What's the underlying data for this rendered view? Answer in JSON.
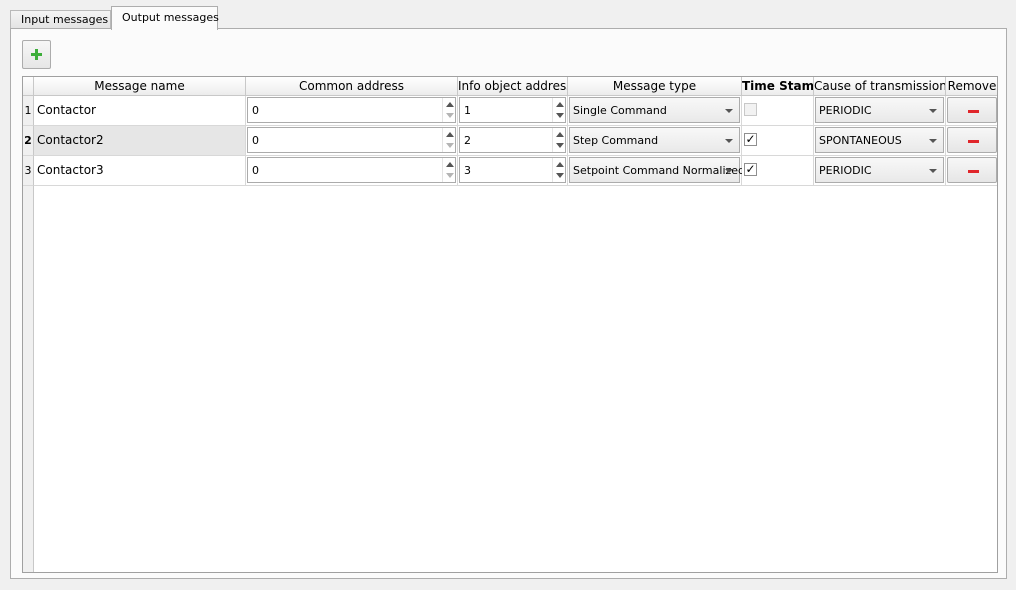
{
  "tabs": [
    {
      "label": "Input messages",
      "active": false
    },
    {
      "label": "Output messages",
      "active": true
    }
  ],
  "toolbar": {
    "add_icon": "plus-icon",
    "accent": "#3dae3a"
  },
  "table": {
    "headers": {
      "name": "Message name",
      "common": "Common address",
      "info": "Info object address",
      "type": "Message type",
      "timestamp": "Time Stamp",
      "cause": "Cause of transmission",
      "remove": "Remove"
    },
    "rows": [
      {
        "num": "1",
        "name": "Contactor",
        "common": "0",
        "info": "1",
        "type": "Single Command",
        "timestamp": false,
        "cause": "PERIODIC"
      },
      {
        "num": "2",
        "name": "Contactor2",
        "common": "0",
        "info": "2",
        "type": "Step Command",
        "timestamp": true,
        "cause": "SPONTANEOUS"
      },
      {
        "num": "3",
        "name": "Contactor3",
        "common": "0",
        "info": "3",
        "type": "Setpoint Command Normalized",
        "timestamp": true,
        "cause": "PERIODIC"
      }
    ],
    "selected_row": 2,
    "check_mark": "✓",
    "remove_icon": "minus-icon",
    "remove_color": "#e0262b"
  }
}
